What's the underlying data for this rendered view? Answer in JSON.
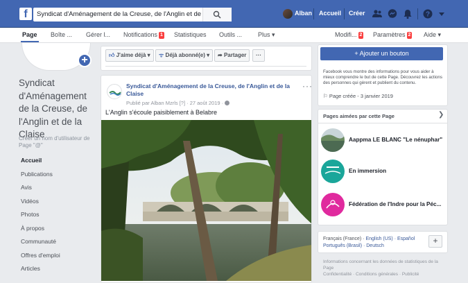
{
  "topbar": {
    "search_value": "Syndicat d'Aménagement de la Creuse, de l'Anglin et de la ...",
    "user_name": "Alban",
    "home_label": "Accueil",
    "create_label": "Créer"
  },
  "page_nav": {
    "page": "Page",
    "inbox": "Boîte ...",
    "manage": "Gérer l...",
    "notifications": "Notifications",
    "notifications_badge": "1",
    "stats": "Statistiques",
    "tools": "Outils ...",
    "more": "Plus ▾",
    "modify": "Modifi...",
    "modify_badge": "2",
    "settings": "Paramètres",
    "settings_badge": "2",
    "help": "Aide ▾"
  },
  "profile": {
    "page_name": "Syndicat d'Aménagement de la Creuse, de l'Anglin et de la Claise",
    "username_prompt": "Créer un nom d'utilisateur de Page \"@\""
  },
  "left_nav": [
    "Accueil",
    "Publications",
    "Avis",
    "Vidéos",
    "Photos",
    "À propos",
    "Communauté",
    "Offres d'emploi",
    "Articles"
  ],
  "action_bar": {
    "like": "J'aime déjà ▾",
    "follow": "Déjà abonné(e) ▾",
    "share": "Partager",
    "more": "···"
  },
  "post": {
    "title": "Syndicat d'Aménagement de la Creuse, de l'Anglin et de la Claise",
    "meta": "Publié par Alban Mzrls [?] · 27 août 2019 ·",
    "text": "L'Anglin s'écoule paisiblement à Belabre",
    "more": "···"
  },
  "sidebar": {
    "cta": "+ Ajouter un bouton",
    "info": "Facebook vous montre des informations pour vous aider à mieux comprendre le but de cette Page. Découvrez les actions des personnes qui gèrent et publient du contenu.",
    "created": "Page créée - 3 janvier 2019",
    "liked_title": "Pages aimées par cette Page",
    "liked_pages": [
      "Aappma LE BLANC \"Le nénuphar\"",
      "En immersion",
      "Fédération de l'Indre pour la Péc..."
    ],
    "lang_current": "Français (France) · ",
    "lang_links": "English (US) · Español",
    "lang_line2_a": "Português (Brasil) · ",
    "lang_line2_b": "Deutsch",
    "footer": "Informations concernant les données de statistiques de la Page\nConfidentialité · Conditions générales · Publicité"
  },
  "colors": {
    "brand": "#4267b2",
    "link": "#385898",
    "badge": "#fa3e3e",
    "background": "#e9ebee"
  }
}
